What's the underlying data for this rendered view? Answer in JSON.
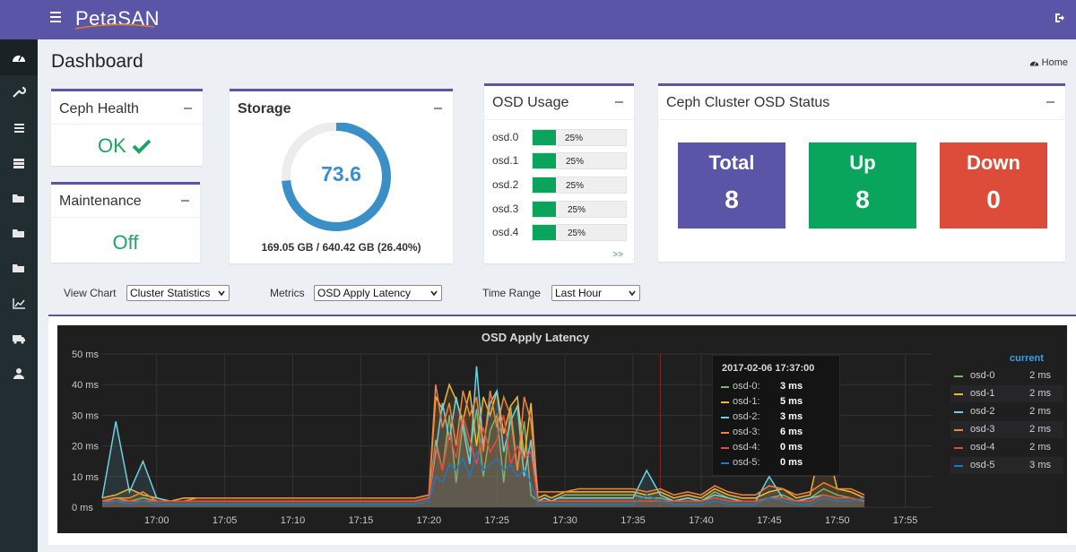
{
  "brand": {
    "logo_text": "PetaSAN",
    "topbar_color": "#5b55a8"
  },
  "header": {
    "title": "Dashboard",
    "home_link": "Home"
  },
  "sidebar": {
    "icons": [
      "dashboard-icon",
      "wrench-icon",
      "list-icon",
      "server-icon",
      "folder-icon",
      "folder-icon",
      "folder-icon",
      "line-chart-icon",
      "ambulance-icon",
      "user-icon"
    ]
  },
  "ceph_health": {
    "title": "Ceph Health",
    "status": "OK",
    "status_color": "#1fa463"
  },
  "maintenance": {
    "title": "Maintenance",
    "status": "Off"
  },
  "storage": {
    "title": "Storage",
    "value": "73.6",
    "used_fraction": 0.736,
    "capacity_text": "169.05 GB / 640.42 GB (26.40%)"
  },
  "osd_usage": {
    "title": "OSD Usage",
    "more": ">>",
    "items": [
      {
        "name": "osd.0",
        "pct": "25%",
        "fraction": 0.25
      },
      {
        "name": "osd.1",
        "pct": "25%",
        "fraction": 0.25
      },
      {
        "name": "osd.2",
        "pct": "25%",
        "fraction": 0.25
      },
      {
        "name": "osd.3",
        "pct": "25%",
        "fraction": 0.25
      },
      {
        "name": "osd.4",
        "pct": "25%",
        "fraction": 0.25
      }
    ]
  },
  "osd_status": {
    "title": "Ceph Cluster OSD Status",
    "total_label": "Total",
    "total": "8",
    "total_color": "#5b55a8",
    "up_label": "Up",
    "up": "8",
    "up_color": "#0aa55c",
    "down_label": "Down",
    "down": "0",
    "down_color": "#dd4b39"
  },
  "filters": {
    "view_chart_label": "View Chart",
    "view_chart_value": "Cluster Statistics",
    "metrics_label": "Metrics",
    "metrics_value": "OSD Apply Latency",
    "time_range_label": "Time Range",
    "time_range_value": "Last Hour"
  },
  "tooltip": {
    "time": "2017-02-06 17:37:00",
    "rows": [
      {
        "name": "osd-0:",
        "value": "3 ms"
      },
      {
        "name": "osd-1:",
        "value": "5 ms"
      },
      {
        "name": "osd-2:",
        "value": "3 ms"
      },
      {
        "name": "osd-3:",
        "value": "6 ms"
      },
      {
        "name": "osd-4:",
        "value": "0 ms"
      },
      {
        "name": "osd-5:",
        "value": "0 ms"
      }
    ]
  },
  "legend": {
    "header": "current",
    "items": [
      {
        "name": "osd-0",
        "value": "2 ms"
      },
      {
        "name": "osd-1",
        "value": "2 ms"
      },
      {
        "name": "osd-2",
        "value": "2 ms"
      },
      {
        "name": "osd-3",
        "value": "2 ms"
      },
      {
        "name": "osd-4",
        "value": "2 ms"
      },
      {
        "name": "osd-5",
        "value": "3 ms"
      }
    ]
  },
  "chart_data": {
    "type": "line",
    "title": "OSD Apply Latency",
    "xlabel": "",
    "ylabel": "",
    "ylim": [
      0,
      50
    ],
    "yticks": [
      "0 ms",
      "10 ms",
      "20 ms",
      "30 ms",
      "40 ms",
      "50 ms"
    ],
    "xticks": [
      "17:00",
      "17:05",
      "17:10",
      "17:15",
      "17:20",
      "17:25",
      "17:30",
      "17:35",
      "17:40",
      "17:45",
      "17:50",
      "17:55"
    ],
    "xlim": [
      -4,
      57
    ],
    "grid": true,
    "legend_position": "right",
    "x": [
      -4,
      -3,
      -2,
      -1,
      0,
      1,
      2,
      3,
      4,
      5,
      6,
      7,
      8,
      9,
      10,
      11,
      12,
      13,
      14,
      15,
      16,
      17,
      18,
      19,
      20,
      20.5,
      21,
      21.5,
      22,
      22.5,
      23,
      23.5,
      24,
      24.5,
      25,
      25.5,
      26,
      26.5,
      27,
      27.5,
      28,
      28.5,
      29,
      29.5,
      30,
      31,
      32,
      33,
      34,
      35,
      36,
      37,
      38,
      39,
      40,
      41,
      42,
      43,
      44,
      45,
      46,
      47,
      48,
      49,
      50,
      51,
      52
    ],
    "series": [
      {
        "name": "osd-0",
        "color": "#7eb26d",
        "values": [
          2,
          3,
          2,
          3,
          2,
          2,
          2,
          2,
          2,
          2,
          2,
          2,
          2,
          2,
          2,
          2,
          2,
          2,
          2,
          2,
          2,
          2,
          2,
          2,
          3,
          22,
          12,
          30,
          8,
          28,
          18,
          32,
          10,
          25,
          30,
          8,
          33,
          12,
          28,
          4,
          2,
          3,
          2,
          3,
          4,
          4,
          4,
          4,
          4,
          4,
          3,
          3,
          2,
          3,
          2,
          5,
          3,
          2,
          2,
          3,
          4,
          2,
          3,
          6,
          4,
          3,
          2
        ]
      },
      {
        "name": "osd-1",
        "color": "#eab839",
        "values": [
          3,
          4,
          6,
          4,
          3,
          2,
          3,
          3,
          3,
          3,
          3,
          3,
          3,
          3,
          3,
          3,
          3,
          3,
          3,
          3,
          3,
          3,
          3,
          3,
          4,
          36,
          32,
          40,
          35,
          28,
          38,
          20,
          36,
          30,
          38,
          24,
          33,
          36,
          16,
          34,
          3,
          4,
          3,
          4,
          5,
          5,
          5,
          5,
          5,
          5,
          4,
          5,
          3,
          4,
          3,
          6,
          4,
          3,
          3,
          5,
          6,
          3,
          4,
          24,
          6,
          5,
          3
        ]
      },
      {
        "name": "osd-2",
        "color": "#6ed0e0",
        "values": [
          3,
          28,
          5,
          15,
          3,
          2,
          2,
          2,
          2,
          2,
          2,
          2,
          2,
          2,
          2,
          2,
          2,
          2,
          2,
          2,
          2,
          2,
          2,
          2,
          3,
          18,
          34,
          22,
          36,
          26,
          14,
          46,
          20,
          34,
          38,
          18,
          28,
          33,
          10,
          22,
          2,
          3,
          2,
          3,
          3,
          3,
          3,
          3,
          3,
          3,
          12,
          4,
          2,
          3,
          2,
          4,
          3,
          2,
          2,
          10,
          3,
          2,
          3,
          4,
          3,
          3,
          2
        ]
      },
      {
        "name": "osd-3",
        "color": "#ef843c",
        "values": [
          2,
          3,
          3,
          5,
          2,
          2,
          2,
          3,
          3,
          3,
          3,
          3,
          3,
          3,
          3,
          3,
          3,
          3,
          3,
          3,
          3,
          3,
          3,
          3,
          4,
          40,
          26,
          34,
          20,
          38,
          30,
          36,
          18,
          38,
          26,
          36,
          30,
          12,
          36,
          28,
          5,
          5,
          5,
          5,
          5,
          6,
          6,
          6,
          6,
          6,
          5,
          6,
          4,
          5,
          4,
          7,
          5,
          4,
          4,
          7,
          6,
          4,
          5,
          8,
          6,
          6,
          4
        ]
      },
      {
        "name": "osd-4",
        "color": "#e24d42",
        "values": [
          2,
          2,
          2,
          2,
          2,
          2,
          2,
          2,
          2,
          2,
          2,
          2,
          2,
          2,
          2,
          2,
          2,
          2,
          2,
          2,
          2,
          2,
          2,
          2,
          3,
          20,
          12,
          24,
          16,
          30,
          22,
          14,
          26,
          18,
          22,
          30,
          14,
          20,
          16,
          18,
          2,
          2,
          2,
          2,
          2,
          2,
          2,
          2,
          2,
          2,
          2,
          2,
          2,
          2,
          2,
          3,
          2,
          2,
          2,
          3,
          3,
          2,
          2,
          4,
          3,
          3,
          2
        ]
      },
      {
        "name": "osd-5",
        "color": "#1f78c1",
        "values": [
          1,
          2,
          1,
          2,
          1,
          1,
          1,
          1,
          1,
          1,
          1,
          1,
          1,
          1,
          1,
          1,
          1,
          1,
          1,
          1,
          1,
          1,
          1,
          1,
          2,
          10,
          8,
          14,
          12,
          16,
          10,
          18,
          12,
          14,
          16,
          12,
          14,
          10,
          12,
          8,
          1,
          1,
          1,
          1,
          1,
          1,
          1,
          1,
          1,
          1,
          4,
          2,
          1,
          1,
          1,
          2,
          1,
          1,
          1,
          3,
          2,
          1,
          1,
          3,
          2,
          2,
          3
        ]
      }
    ],
    "marker_time": "17:37"
  }
}
